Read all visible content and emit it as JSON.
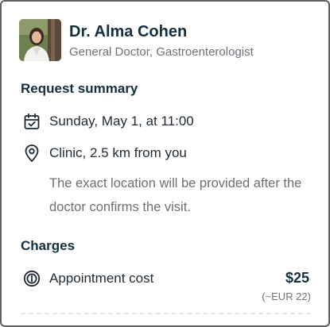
{
  "doctor": {
    "name": "Dr. Alma Cohen",
    "specialty": "General Doctor, Gastroenterologist"
  },
  "summary": {
    "title": "Request summary",
    "date_text": "Sunday, May 1, at 11:00",
    "location_text": "Clinic, 2.5 km from you",
    "location_note": "The exact location will be provided after the doctor confirms the visit."
  },
  "charges": {
    "title": "Charges",
    "item_label": "Appointment cost",
    "price": "$25",
    "price_converted": "(~EUR 22)"
  },
  "icons": {
    "date": "calendar-check-icon",
    "location": "location-pin-icon",
    "cost": "coin-icon"
  },
  "colors": {
    "heading": "#14303f",
    "muted": "#6c7278",
    "border": "#5f5f5f"
  }
}
